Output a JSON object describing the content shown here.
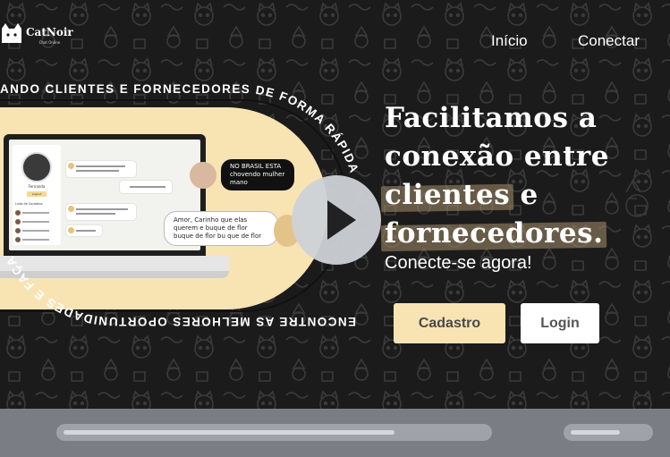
{
  "header": {
    "brand": "CatNoir",
    "brand_tagline": "Chat Online",
    "nav": [
      {
        "label": "Início"
      },
      {
        "label": "Conectar"
      }
    ]
  },
  "hero": {
    "circular_text": "ANDO CLIENTES E FORNECEDORES DE FORMA RÁPIDA · ENCONTRE AS MELHORES OPORTUNIDADES E FAÇA",
    "circular_top": "ANDO CLIENTES E FORNECEDORES DE FORMA RÁPIDA",
    "circular_bottom": "ENCONTRE AS MELHORES OPORTUNIDADES E FAÇA",
    "headline_lines": [
      "Facilitamos a",
      "conexão entre",
      "clientes",
      "e",
      "fornecedores."
    ],
    "subline": "Conecte-se agora!",
    "buttons": {
      "signup": "Cadastro",
      "login": "Login"
    },
    "bubble_dark": "NO BRASIL ESTA chovendo mulher mano",
    "bubble_light": "Amor, Carinho que elas querem e buque de flor buque de flor bu que de flor"
  },
  "mockup": {
    "profile_name": "Fernanda",
    "profile_button": "Logout",
    "contacts_title": "Lista de Contatos"
  },
  "colors": {
    "accent_cream": "#f8e3b3",
    "highlight": "#a58f6c",
    "background": "#1b1b1b",
    "play": "#cdd2d7"
  },
  "icons": [
    "cat-logo-icon",
    "play-icon"
  ]
}
